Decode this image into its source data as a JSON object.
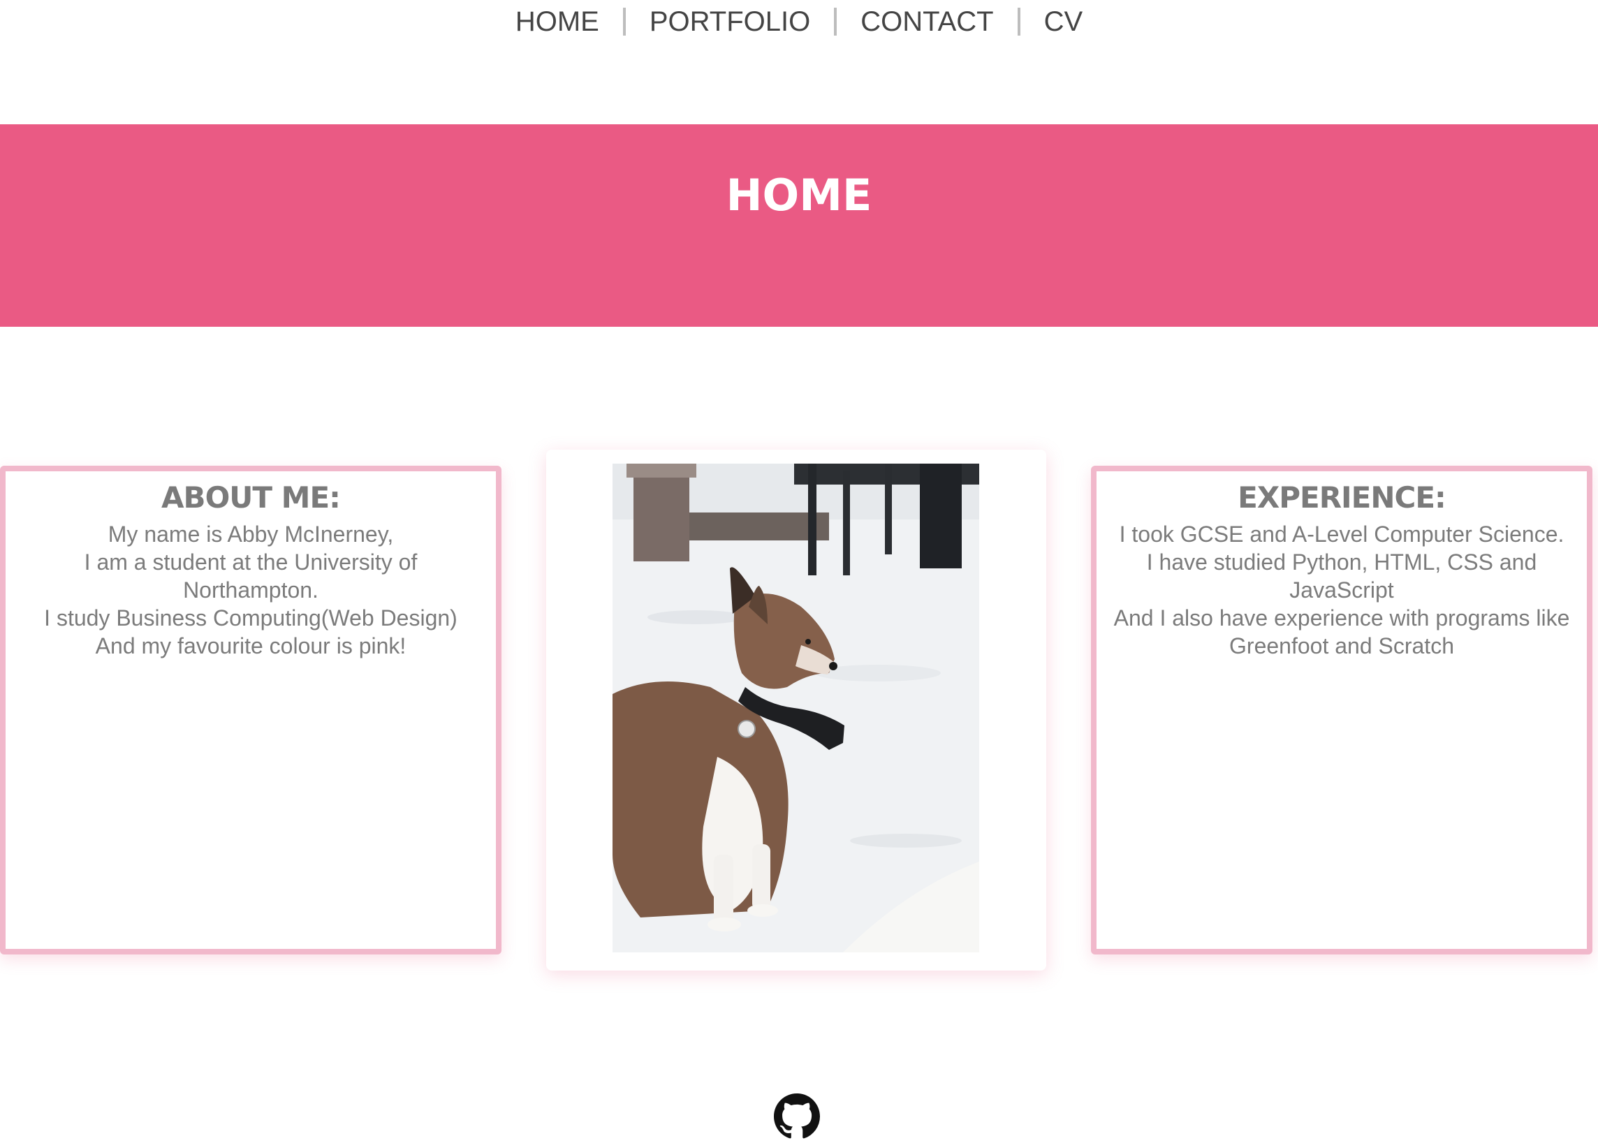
{
  "nav": {
    "items": [
      {
        "label": "HOME"
      },
      {
        "label": "PORTFOLIO"
      },
      {
        "label": "CONTACT"
      },
      {
        "label": "CV"
      }
    ]
  },
  "banner": {
    "title": "HOME",
    "color": "#ea5a84"
  },
  "about": {
    "heading": "ABOUT ME:",
    "lines": [
      "My name is Abby McInerney,",
      "I am a student at the University of",
      "Northampton.",
      "I study Business Computing(Web Design)",
      "And my favourite colour is pink!"
    ]
  },
  "photo": {
    "icon": "dog-photo"
  },
  "experience": {
    "heading": "EXPERIENCE:",
    "lines": [
      "I took GCSE and A-Level Computer Science.",
      "I have studied Python, HTML, CSS and",
      "JavaScript",
      "And I also have experience with programs like",
      "Greenfoot and Scratch"
    ]
  },
  "footer": {
    "icon": "github-icon"
  },
  "colors": {
    "accent": "#ea5a84",
    "card_border": "#f1b8cb",
    "text": "#777777"
  }
}
